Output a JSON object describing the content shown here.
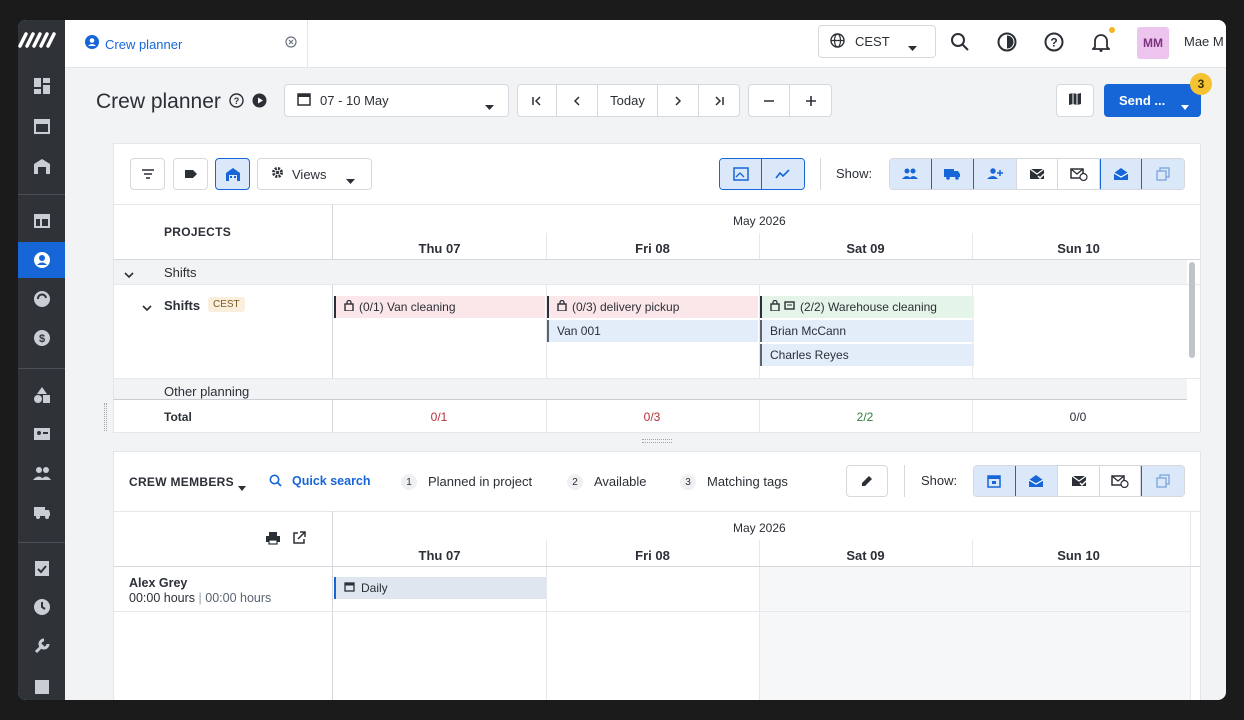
{
  "topbar": {
    "tab_label": "Crew planner",
    "timezone": "CEST",
    "user_initials": "MM",
    "user_name": "Mae M"
  },
  "toolbar": {
    "page_title": "Crew planner",
    "date_range": "07 - 10 May",
    "today_label": "Today",
    "send_label": "Send ...",
    "send_badge": "3"
  },
  "projects_panel": {
    "views_label": "Views",
    "show_label": "Show:",
    "projects_header": "PROJECTS",
    "month_label": "May 2026",
    "days": [
      "Thu 07",
      "Fri 08",
      "Sat 09",
      "Sun 10"
    ],
    "group_row": "Shifts",
    "subgroup_row": "Shifts",
    "subgroup_tag": "CEST",
    "other_row": "Other planning",
    "total_label": "Total",
    "totals": [
      "0/1",
      "0/3",
      "2/2",
      "0/0"
    ],
    "events": {
      "van_cleaning": "(0/1) Van cleaning",
      "delivery_pickup": "(0/3) delivery pickup",
      "van_001": "Van 001",
      "warehouse_cleaning": "(2/2) Warehouse cleaning",
      "brian": "Brian McCann",
      "charles": "Charles Reyes"
    }
  },
  "crew_panel": {
    "crew_header": "CREW MEMBERS",
    "quick_search": "Quick search",
    "legend": [
      {
        "num": "1",
        "label": "Planned in project"
      },
      {
        "num": "2",
        "label": "Available"
      },
      {
        "num": "3",
        "label": "Matching tags"
      }
    ],
    "show_label": "Show:",
    "month_label": "May 2026",
    "days": [
      "Thu 07",
      "Fri 08",
      "Sat 09",
      "Sun 10"
    ],
    "member_name": "Alex Grey",
    "member_hours_a": "00:00 hours",
    "member_hours_sep": "|",
    "member_hours_b": "00:00 hours",
    "daily_label": "Daily"
  },
  "colors": {
    "accent": "#1666d8",
    "rail": "#2f3338",
    "badge": "#f5c332",
    "avatar_bg": "#ecc4ee"
  }
}
